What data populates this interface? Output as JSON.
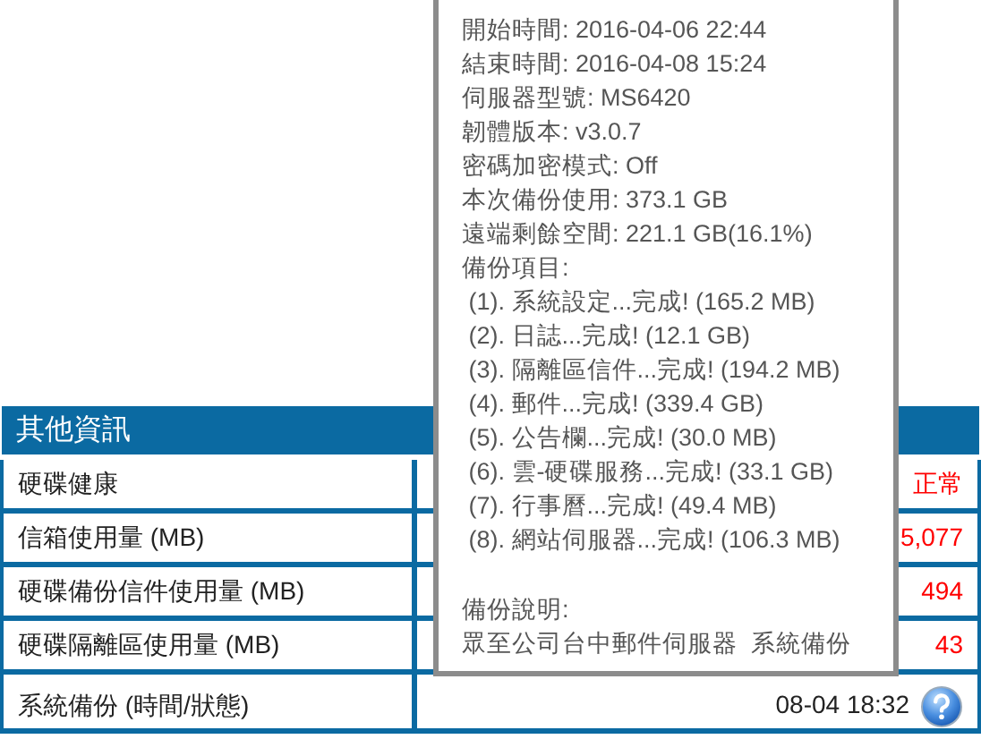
{
  "panel": {
    "title": "其他資訊",
    "rows": [
      {
        "label": "硬碟健康",
        "value": "正常",
        "kind": "alert"
      },
      {
        "label": "信箱使用量 (MB)",
        "value": "5,077",
        "kind": "alert"
      },
      {
        "label": "硬碟備份信件使用量 (MB)",
        "value": "494",
        "kind": "alert"
      },
      {
        "label": "硬碟隔離區使用量 (MB)",
        "value": "43",
        "kind": "alert"
      },
      {
        "label": "系統備份 (時間/狀態)",
        "value": "08-04 18:32",
        "kind": "help"
      }
    ]
  },
  "tooltip": {
    "lines": [
      "開始時間: 2016-04-06 22:44",
      "結束時間: 2016-04-08 15:24",
      "伺服器型號: MS6420",
      "韌體版本: v3.0.7",
      "密碼加密模式: Off",
      "本次備份使用: 373.1 GB",
      "遠端剩餘空間: 221.1 GB(16.1%)",
      "備份項目:"
    ],
    "items": [
      " (1). 系統設定...完成! (165.2 MB)",
      " (2). 日誌...完成! (12.1 GB)",
      " (3). 隔離區信件...完成! (194.2 MB)",
      " (4). 郵件...完成! (339.4 GB)",
      " (5). 公告欄...完成! (30.0 MB)",
      " (6). 雲-硬碟服務...完成! (33.1 GB)",
      " (7). 行事曆...完成! (49.4 MB)",
      " (8). 網站伺服器...完成! (106.3 MB)"
    ],
    "description_label": "備份說明:",
    "description": "眾至公司台中郵件伺服器  系統備份"
  }
}
